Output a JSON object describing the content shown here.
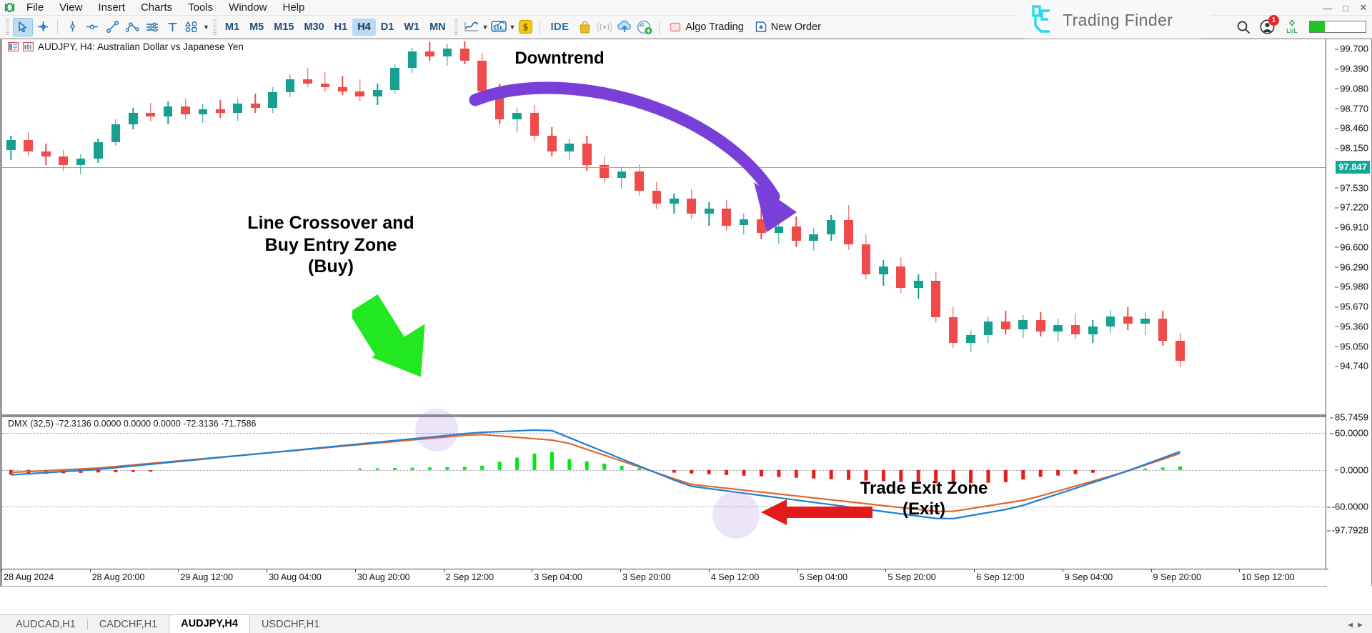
{
  "app": {
    "logo_icon": "metatrader-logo-icon",
    "menu": [
      "File",
      "View",
      "Insert",
      "Charts",
      "Tools",
      "Window",
      "Help"
    ],
    "window_controls": [
      "minimize",
      "maximize",
      "close"
    ]
  },
  "toolbar": {
    "cursor_tools": [
      {
        "icon": "arrow-cursor-icon",
        "active": true
      },
      {
        "icon": "crosshair-icon",
        "active": false
      },
      {
        "icon": "vertical-line-icon",
        "active": false
      },
      {
        "icon": "horizontal-line-icon",
        "active": false
      },
      {
        "icon": "trendline-icon",
        "active": false
      },
      {
        "icon": "polyline-icon",
        "active": false
      },
      {
        "icon": "equidistant-channel-icon",
        "active": false
      },
      {
        "icon": "text-label-icon",
        "active": false
      },
      {
        "icon": "shapes-icon",
        "active": false
      }
    ],
    "timeframes": [
      "M1",
      "M5",
      "M15",
      "M30",
      "H1",
      "H4",
      "D1",
      "W1",
      "MN"
    ],
    "active_timeframe": "H4",
    "chart_type_icon": "line-chart-icon",
    "indicators_icon": "indicators-chart-icon",
    "currency_icon": "dollar-icon",
    "ide_label": "IDE",
    "market_icon": "shopping-bag-icon",
    "signals_icon": "signal-broadcast-icon",
    "vps_icon": "cloud-upload-icon",
    "copy_signal_icon": "copy-signals-icon",
    "algo_trading_label": "Algo Trading",
    "algo_trading_icon": "algo-square-icon",
    "new_order_label": "New Order",
    "new_order_icon": "plus-square-icon",
    "search_icon": "search-icon",
    "account_icon": "account-avatar-icon",
    "notification_count": "1",
    "level_icon": "lvl-icon",
    "level_fill_percent": 27
  },
  "watermark": {
    "brand": "Trading Finder",
    "logo_icon": "trading-finder-logo-icon",
    "accent": "#26dbf0"
  },
  "chart": {
    "title": "AUDJPY, H4:  Australian Dollar vs Japanese Yen",
    "symbol": "AUDJPY",
    "timeframe": "H4",
    "description": "Australian Dollar vs Japanese Yen",
    "current_price": "97.847",
    "bull_color": "#17a08f",
    "bear_color": "#ef4b4b"
  },
  "indicator": {
    "label": "DMX (32,5) -72.3136 0.0000 0.0000 0.0000 -72.3136 -71.7586",
    "name": "DMX",
    "params": "(32,5)",
    "values": [
      "-72.3136",
      "0.0000",
      "0.0000",
      "0.0000",
      "-72.3136",
      "-71.7586"
    ],
    "line_blue": "#1f7fd6",
    "line_orange": "#e0672e",
    "hist_up": "#00e817",
    "hist_down": "#e32020"
  },
  "annotations": [
    {
      "id": "downtrend",
      "text": "Downtrend",
      "arrow_color": "#7a3fd8"
    },
    {
      "id": "buy-entry",
      "text": "Line Crossover and\nBuy Entry Zone\n(Buy)",
      "line1": "Line Crossover and",
      "line2": "Buy Entry Zone",
      "line3": "(Buy)",
      "arrow_color": "#22e822"
    },
    {
      "id": "trade-exit",
      "text": "Trade Exit Zone\n(Exit)",
      "line1": "Trade Exit Zone",
      "line2": "(Exit)",
      "arrow_color": "#e31b1b"
    }
  ],
  "chart_data": {
    "type": "candlestick",
    "title": "AUDJPY, H4:  Australian Dollar vs Japanese Yen",
    "xlabel": "",
    "ylabel": "",
    "grid": false,
    "legend": "none",
    "price_axis": {
      "ticks": [
        "99.700",
        "99.390",
        "99.080",
        "98.770",
        "98.460",
        "98.150",
        "97.847",
        "97.530",
        "97.220",
        "96.910",
        "96.600",
        "96.290",
        "95.980",
        "95.670",
        "95.360",
        "95.050",
        "94.740"
      ],
      "current": "97.847",
      "ylim": [
        94.6,
        99.85
      ]
    },
    "time_axis": {
      "ticks": [
        "28 Aug 2024",
        "28 Aug 20:00",
        "29 Aug 12:00",
        "30 Aug 04:00",
        "30 Aug 20:00",
        "2 Sep 12:00",
        "3 Sep 04:00",
        "3 Sep 20:00",
        "4 Sep 12:00",
        "5 Sep 04:00",
        "5 Sep 20:00",
        "6 Sep 12:00",
        "9 Sep 04:00",
        "9 Sep 20:00",
        "10 Sep 12:00"
      ]
    },
    "candles": [
      {
        "o": 98.12,
        "h": 98.34,
        "l": 97.96,
        "c": 98.28
      },
      {
        "o": 98.28,
        "h": 98.4,
        "l": 98.02,
        "c": 98.1
      },
      {
        "o": 98.1,
        "h": 98.22,
        "l": 97.88,
        "c": 98.02
      },
      {
        "o": 98.02,
        "h": 98.12,
        "l": 97.8,
        "c": 97.88
      },
      {
        "o": 97.88,
        "h": 98.05,
        "l": 97.74,
        "c": 97.99
      },
      {
        "o": 97.99,
        "h": 98.3,
        "l": 97.92,
        "c": 98.24
      },
      {
        "o": 98.24,
        "h": 98.6,
        "l": 98.18,
        "c": 98.52
      },
      {
        "o": 98.52,
        "h": 98.78,
        "l": 98.44,
        "c": 98.7
      },
      {
        "o": 98.7,
        "h": 98.86,
        "l": 98.56,
        "c": 98.64
      },
      {
        "o": 98.64,
        "h": 98.88,
        "l": 98.52,
        "c": 98.8
      },
      {
        "o": 98.8,
        "h": 98.92,
        "l": 98.6,
        "c": 98.68
      },
      {
        "o": 98.68,
        "h": 98.84,
        "l": 98.54,
        "c": 98.76
      },
      {
        "o": 98.76,
        "h": 98.9,
        "l": 98.62,
        "c": 98.7
      },
      {
        "o": 98.7,
        "h": 98.92,
        "l": 98.58,
        "c": 98.84
      },
      {
        "o": 98.84,
        "h": 99.0,
        "l": 98.7,
        "c": 98.78
      },
      {
        "o": 98.78,
        "h": 99.1,
        "l": 98.7,
        "c": 99.02
      },
      {
        "o": 99.02,
        "h": 99.3,
        "l": 98.94,
        "c": 99.22
      },
      {
        "o": 99.22,
        "h": 99.4,
        "l": 99.1,
        "c": 99.16
      },
      {
        "o": 99.16,
        "h": 99.34,
        "l": 99.02,
        "c": 99.1
      },
      {
        "o": 99.1,
        "h": 99.28,
        "l": 98.98,
        "c": 99.04
      },
      {
        "o": 99.04,
        "h": 99.22,
        "l": 98.88,
        "c": 98.96
      },
      {
        "o": 98.96,
        "h": 99.16,
        "l": 98.82,
        "c": 99.06
      },
      {
        "o": 99.06,
        "h": 99.46,
        "l": 99.0,
        "c": 99.4
      },
      {
        "o": 99.4,
        "h": 99.72,
        "l": 99.32,
        "c": 99.66
      },
      {
        "o": 99.66,
        "h": 99.8,
        "l": 99.52,
        "c": 99.58
      },
      {
        "o": 99.58,
        "h": 99.78,
        "l": 99.44,
        "c": 99.7
      },
      {
        "o": 99.7,
        "h": 99.82,
        "l": 99.46,
        "c": 99.52
      },
      {
        "o": 99.52,
        "h": 99.64,
        "l": 98.96,
        "c": 99.04
      },
      {
        "o": 99.04,
        "h": 99.16,
        "l": 98.52,
        "c": 98.6
      },
      {
        "o": 98.6,
        "h": 98.78,
        "l": 98.4,
        "c": 98.7
      },
      {
        "o": 98.7,
        "h": 98.82,
        "l": 98.26,
        "c": 98.34
      },
      {
        "o": 98.34,
        "h": 98.48,
        "l": 98.02,
        "c": 98.1
      },
      {
        "o": 98.1,
        "h": 98.3,
        "l": 97.96,
        "c": 98.22
      },
      {
        "o": 98.22,
        "h": 98.34,
        "l": 97.8,
        "c": 97.88
      },
      {
        "o": 97.88,
        "h": 98.02,
        "l": 97.6,
        "c": 97.68
      },
      {
        "o": 97.68,
        "h": 97.86,
        "l": 97.52,
        "c": 97.78
      },
      {
        "o": 97.78,
        "h": 97.9,
        "l": 97.4,
        "c": 97.48
      },
      {
        "o": 97.48,
        "h": 97.62,
        "l": 97.2,
        "c": 97.28
      },
      {
        "o": 97.28,
        "h": 97.44,
        "l": 97.12,
        "c": 97.36
      },
      {
        "o": 97.36,
        "h": 97.5,
        "l": 97.04,
        "c": 97.12
      },
      {
        "o": 97.12,
        "h": 97.3,
        "l": 96.94,
        "c": 97.2
      },
      {
        "o": 97.2,
        "h": 97.34,
        "l": 96.86,
        "c": 96.94
      },
      {
        "o": 96.94,
        "h": 97.12,
        "l": 96.8,
        "c": 97.04
      },
      {
        "o": 97.04,
        "h": 97.2,
        "l": 96.72,
        "c": 96.82
      },
      {
        "o": 96.82,
        "h": 97.0,
        "l": 96.66,
        "c": 96.92
      },
      {
        "o": 96.92,
        "h": 97.08,
        "l": 96.6,
        "c": 96.7
      },
      {
        "o": 96.7,
        "h": 96.9,
        "l": 96.54,
        "c": 96.8
      },
      {
        "o": 96.8,
        "h": 97.1,
        "l": 96.7,
        "c": 97.02
      },
      {
        "o": 97.02,
        "h": 97.26,
        "l": 96.56,
        "c": 96.64
      },
      {
        "o": 96.64,
        "h": 96.8,
        "l": 96.1,
        "c": 96.18
      },
      {
        "o": 96.18,
        "h": 96.4,
        "l": 96.0,
        "c": 96.3
      },
      {
        "o": 96.3,
        "h": 96.44,
        "l": 95.88,
        "c": 95.96
      },
      {
        "o": 95.96,
        "h": 96.18,
        "l": 95.8,
        "c": 96.08
      },
      {
        "o": 96.08,
        "h": 96.22,
        "l": 95.42,
        "c": 95.5
      },
      {
        "o": 95.5,
        "h": 95.66,
        "l": 95.02,
        "c": 95.1
      },
      {
        "o": 95.1,
        "h": 95.3,
        "l": 94.96,
        "c": 95.22
      },
      {
        "o": 95.22,
        "h": 95.52,
        "l": 95.1,
        "c": 95.44
      },
      {
        "o": 95.44,
        "h": 95.6,
        "l": 95.24,
        "c": 95.32
      },
      {
        "o": 95.32,
        "h": 95.54,
        "l": 95.18,
        "c": 95.46
      },
      {
        "o": 95.46,
        "h": 95.58,
        "l": 95.2,
        "c": 95.28
      },
      {
        "o": 95.28,
        "h": 95.48,
        "l": 95.12,
        "c": 95.38
      },
      {
        "o": 95.38,
        "h": 95.56,
        "l": 95.16,
        "c": 95.24
      },
      {
        "o": 95.24,
        "h": 95.46,
        "l": 95.1,
        "c": 95.36
      },
      {
        "o": 95.36,
        "h": 95.62,
        "l": 95.26,
        "c": 95.52
      },
      {
        "o": 95.52,
        "h": 95.66,
        "l": 95.3,
        "c": 95.4
      },
      {
        "o": 95.4,
        "h": 95.58,
        "l": 95.22,
        "c": 95.48
      },
      {
        "o": 95.48,
        "h": 95.6,
        "l": 95.06,
        "c": 95.14
      },
      {
        "o": 95.14,
        "h": 95.26,
        "l": 94.72,
        "c": 94.82
      }
    ],
    "dmx": {
      "type": "line+histogram",
      "ylim": [
        -97.7928,
        85.7459
      ],
      "yticks": [
        "85.7459",
        "60.0000",
        "0.0000",
        "-60.0000",
        "-97.7928"
      ],
      "series": [
        {
          "name": "line-blue",
          "color": "#1f7fd6"
        },
        {
          "name": "line-orange",
          "color": "#e0672e"
        },
        {
          "name": "histogram",
          "color_up": "#00e817",
          "color_down": "#e32020"
        }
      ]
    }
  },
  "tabs": {
    "items": [
      {
        "label": "AUDCAD,H1",
        "active": false
      },
      {
        "label": "CADCHF,H1",
        "active": false
      },
      {
        "label": "AUDJPY,H4",
        "active": true
      },
      {
        "label": "USDCHF,H1",
        "active": false
      }
    ],
    "scroll_left_icon": "chevron-left-icon",
    "scroll_right_icon": "chevron-right-icon"
  }
}
